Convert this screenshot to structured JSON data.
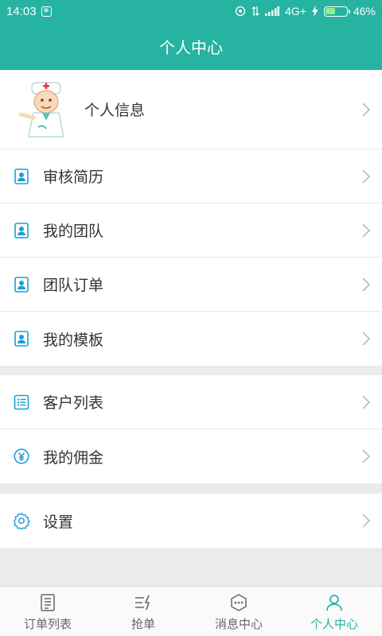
{
  "status_bar": {
    "time": "14:03",
    "network": "4G+",
    "battery": "46%",
    "battery_level": 0.46
  },
  "header": {
    "title": "个人中心"
  },
  "profile": {
    "label": "个人信息"
  },
  "menu_group_1": [
    {
      "label": "审核简历",
      "icon": "contact-card-icon"
    },
    {
      "label": "我的团队",
      "icon": "contact-card-icon"
    },
    {
      "label": "团队订单",
      "icon": "contact-card-icon"
    },
    {
      "label": "我的模板",
      "icon": "contact-card-icon"
    }
  ],
  "menu_group_2": [
    {
      "label": "客户列表",
      "icon": "list-icon"
    },
    {
      "label": "我的佣金",
      "icon": "yen-coin-icon"
    }
  ],
  "menu_group_3": [
    {
      "label": "设置",
      "icon": "gear-icon"
    }
  ],
  "tab_bar": {
    "active_index": 3,
    "tabs": [
      {
        "label": "订单列表",
        "icon": "document-list-icon"
      },
      {
        "label": "抢单",
        "icon": "grab-order-icon"
      },
      {
        "label": "消息中心",
        "icon": "chat-bubble-icon"
      },
      {
        "label": "个人中心",
        "icon": "person-icon"
      }
    ]
  },
  "colors": {
    "primary": "#26b3a2",
    "icon_blue": "#1a9fd6",
    "background": "#ebebeb"
  }
}
